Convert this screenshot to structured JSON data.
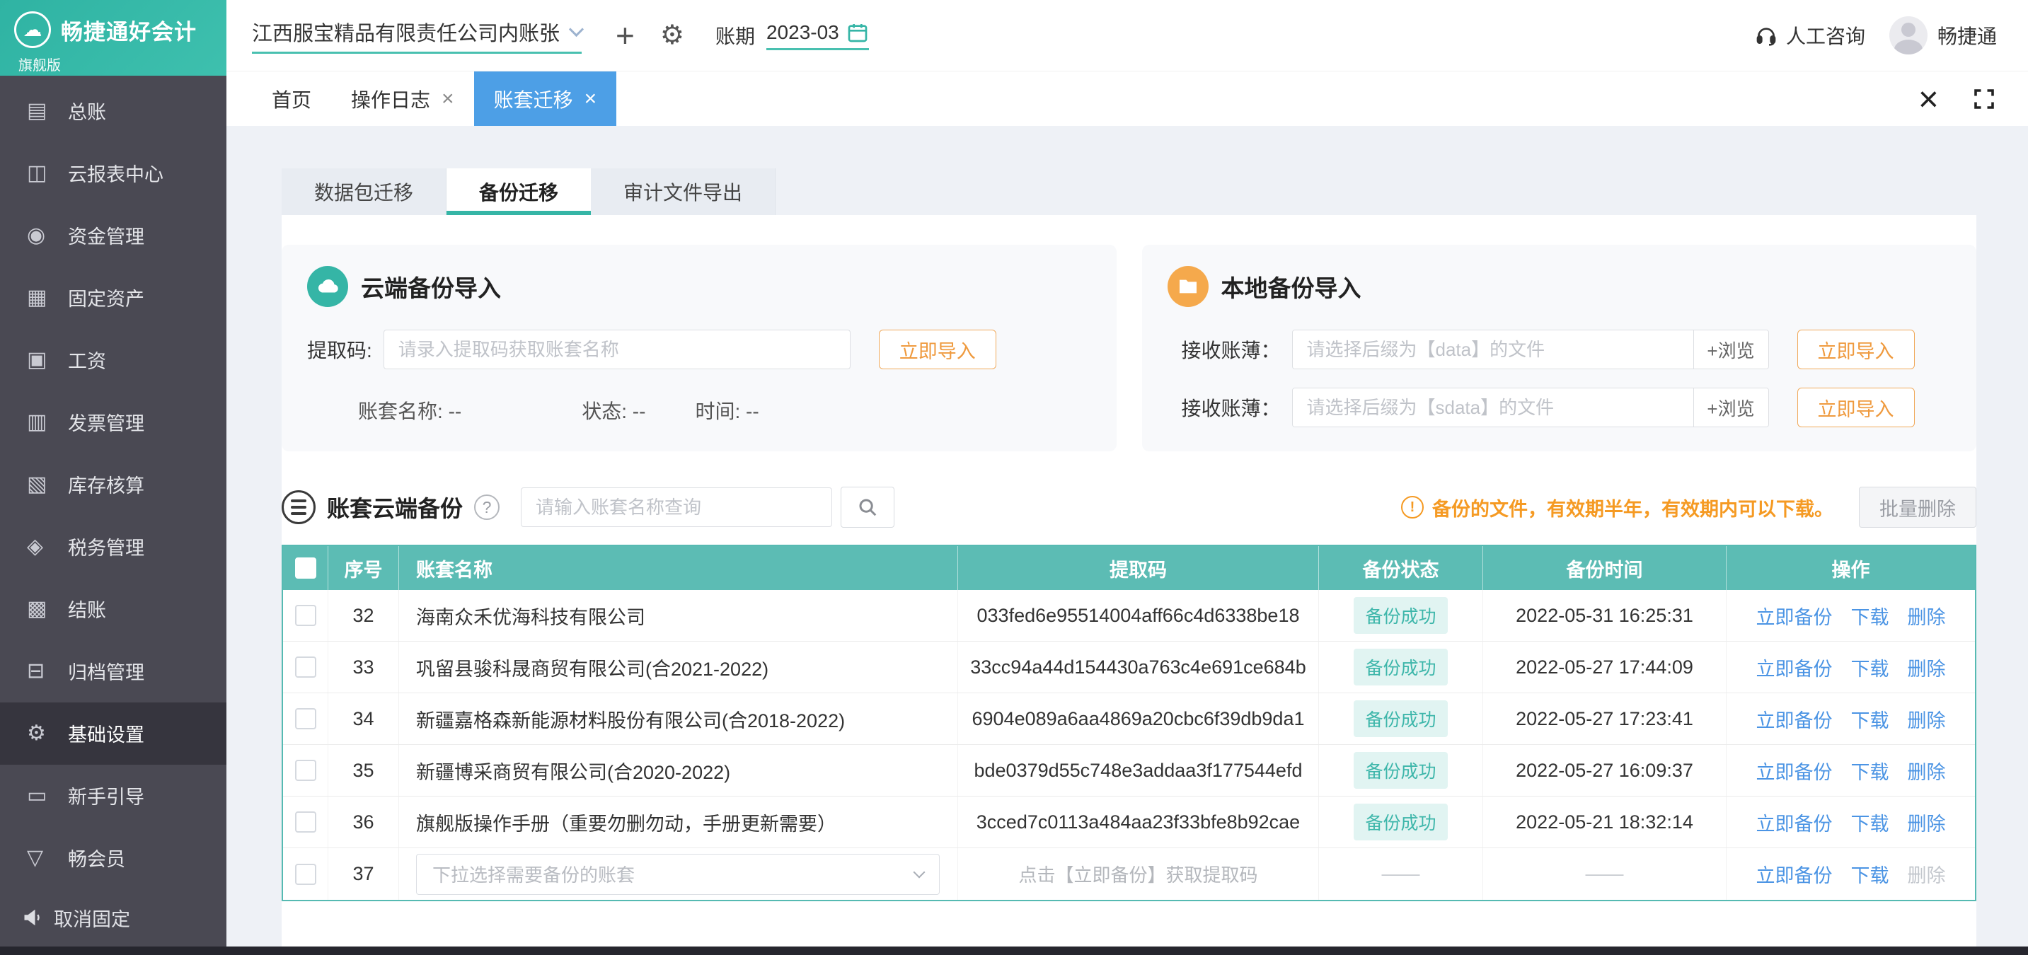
{
  "theme": {
    "accent_teal": "#35b5a6",
    "table_header_teal": "#5cbcb4",
    "active_tab_blue": "#4d9fe6",
    "link_blue": "#4b94e4",
    "warning_orange": "#f59a23",
    "button_orange": "#ef9a3e",
    "sidebar_bg": "#4a4953",
    "sidebar_active_bg": "#36353e",
    "page_bg": "#eef1f6",
    "badge_bg": "#e1f4f2",
    "badge_text": "#3db6aa"
  },
  "sidebar": {
    "logo": {
      "icon": "☁",
      "title": "畅捷通好会计",
      "badge": "旗舰版"
    },
    "items": [
      {
        "label": "总账",
        "icon": "▤"
      },
      {
        "label": "云报表中心",
        "icon": "◫"
      },
      {
        "label": "资金管理",
        "icon": "◉"
      },
      {
        "label": "固定资产",
        "icon": "▦"
      },
      {
        "label": "工资",
        "icon": "▣"
      },
      {
        "label": "发票管理",
        "icon": "▥"
      },
      {
        "label": "库存核算",
        "icon": "▧"
      },
      {
        "label": "税务管理",
        "icon": "◈"
      },
      {
        "label": "结账",
        "icon": "▩"
      },
      {
        "label": "归档管理",
        "icon": "⊟"
      },
      {
        "label": "基础设置",
        "icon": "⚙"
      },
      {
        "label": "新手引导",
        "icon": "▭"
      },
      {
        "label": "畅会员",
        "icon": "▽"
      }
    ],
    "unpin_label": "取消固定"
  },
  "topbar": {
    "company": "江西服宝精品有限责任公司内账张",
    "add_icon": "+",
    "settings_icon": "⚙",
    "period_label": "账期",
    "period_value": "2023-03",
    "support_label": "人工咨询",
    "user_name": "畅捷通"
  },
  "tabbar": {
    "tabs": [
      {
        "label": "首页"
      },
      {
        "label": "操作日志",
        "close": "×"
      },
      {
        "label": "账套迁移",
        "close": "×"
      }
    ],
    "close_icon": "×"
  },
  "subtabs": [
    {
      "label": "数据包迁移"
    },
    {
      "label": "备份迁移"
    },
    {
      "label": "审计文件导出"
    }
  ],
  "cloud_import": {
    "title": "云端备份导入",
    "code_label": "提取码:",
    "code_placeholder": "请录入提取码获取账套名称",
    "import_button": "立即导入",
    "name_label": "账套名称:",
    "name_value": "--",
    "status_label": "状态:",
    "status_value": "--",
    "time_label": "时间:",
    "time_value": "--"
  },
  "local_import": {
    "title": "本地备份导入",
    "rows": [
      {
        "label": "接收账薄：",
        "placeholder": "请选择后缀为【data】的文件",
        "browse_label": "+浏览",
        "import_button": "立即导入"
      },
      {
        "label": "接收账薄：",
        "placeholder": "请选择后缀为【sdata】的文件",
        "browse_label": "+浏览",
        "import_button": "立即导入"
      }
    ]
  },
  "backup": {
    "title": "账套云端备份",
    "help_icon": "?",
    "warn_icon": "!",
    "search_placeholder": "请输入账套名称查询",
    "warning_text": "备份的文件，有效期半年，有效期内可以下载。",
    "batch_delete_label": "批量删除",
    "table": {
      "headers": {
        "no": "序号",
        "name": "账套名称",
        "code": "提取码",
        "status": "备份状态",
        "time": "备份时间",
        "ops": "操作"
      },
      "actions": {
        "backup": "立即备份",
        "download": "下载",
        "delete": "删除"
      },
      "rows": [
        {
          "no": "32",
          "name": "海南众禾优海科技有限公司",
          "code": "033fed6e95514004aff66c4d6338be18",
          "status": "备份成功",
          "time": "2022-05-31 16:25:31"
        },
        {
          "no": "33",
          "name": "巩留县骏科晟商贸有限公司(合2021-2022)",
          "code": "33cc94a44d154430a763c4e691ce684b",
          "status": "备份成功",
          "time": "2022-05-27 17:44:09"
        },
        {
          "no": "34",
          "name": "新疆嘉格森新能源材料股份有限公司(合2018-2022)",
          "code": "6904e089a6aa4869a20cbc6f39db9da1",
          "status": "备份成功",
          "time": "2022-05-27 17:23:41"
        },
        {
          "no": "35",
          "name": "新疆博采商贸有限公司(合2020-2022)",
          "code": "bde0379d55c748e3addaa3f177544efd",
          "status": "备份成功",
          "time": "2022-05-27 16:09:37"
        },
        {
          "no": "36",
          "name": "旗舰版操作手册（重要勿删勿动，手册更新需要）",
          "code": "3cced7c0113a484aa23f33bfe8b92cae",
          "status": "备份成功",
          "time": "2022-05-21 18:32:14"
        }
      ],
      "draft_row": {
        "no": "37",
        "select_placeholder": "下拉选择需要备份的账套",
        "code_hint": "点击【立即备份】获取提取码",
        "empty_dash": "——"
      }
    }
  }
}
